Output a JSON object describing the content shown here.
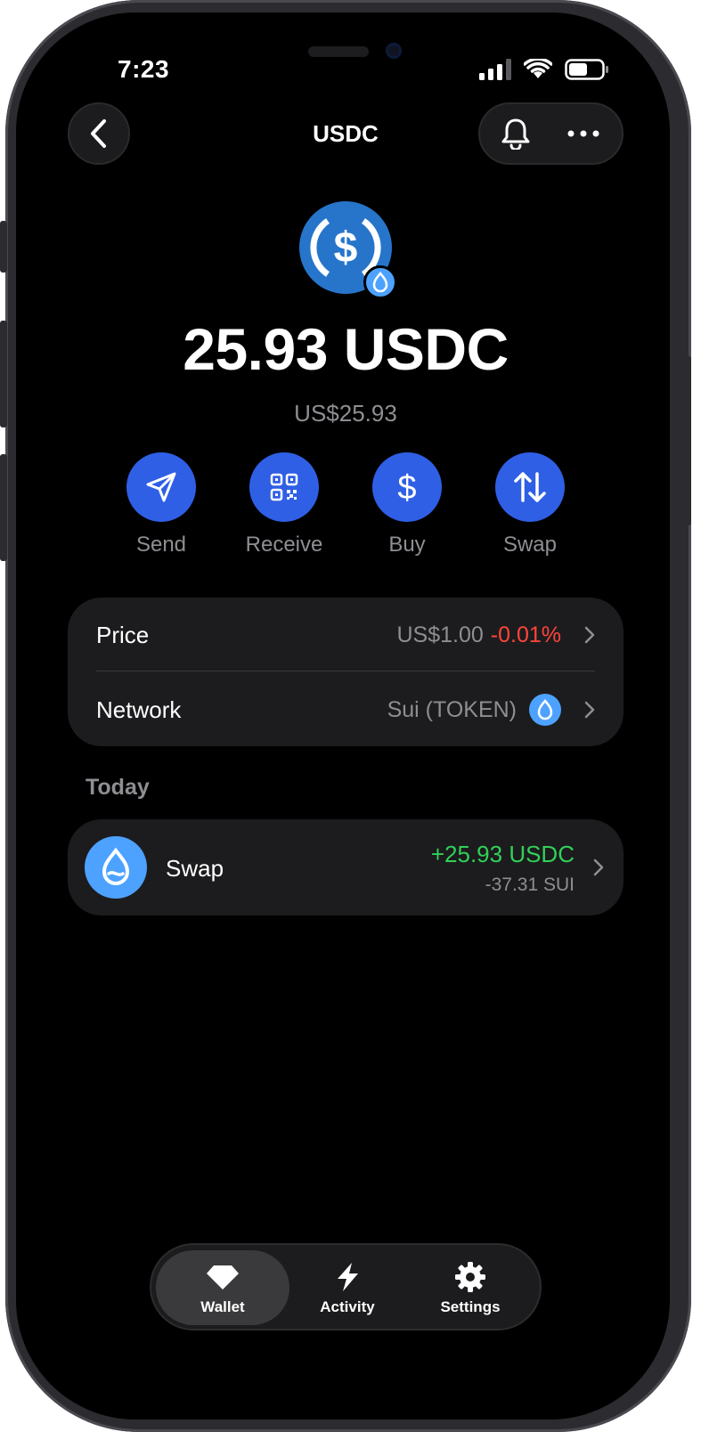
{
  "status_bar": {
    "time": "7:23"
  },
  "nav": {
    "title": "USDC",
    "back_icon": "chevron-left-icon",
    "bell_icon": "bell-icon",
    "more_icon": "more-dots-icon"
  },
  "token": {
    "logo_icon": "usdc-logo-icon",
    "badge_icon": "sui-drop-icon",
    "balance": "25.93 USDC",
    "fiat_value": "US$25.93"
  },
  "actions": [
    {
      "label": "Send",
      "icon": "send-icon"
    },
    {
      "label": "Receive",
      "icon": "qr-code-icon"
    },
    {
      "label": "Buy",
      "icon": "dollar-icon"
    },
    {
      "label": "Swap",
      "icon": "swap-arrows-icon"
    }
  ],
  "info": {
    "price_label": "Price",
    "price_value": "US$1.00",
    "price_change": "-0.01%",
    "network_label": "Network",
    "network_value": "Sui (TOKEN)"
  },
  "activity": {
    "section_label": "Today",
    "transactions": [
      {
        "title": "Swap",
        "amount_in": "+25.93 USDC",
        "amount_out": "-37.31 SUI"
      }
    ]
  },
  "tabbar": {
    "tabs": [
      {
        "label": "Wallet",
        "icon": "diamond-icon",
        "active": true
      },
      {
        "label": "Activity",
        "icon": "lightning-icon",
        "active": false
      },
      {
        "label": "Settings",
        "icon": "gear-icon",
        "active": false
      }
    ]
  },
  "colors": {
    "accent": "#2f5fe5",
    "sui_blue": "#4da2ff",
    "negative": "#ff453a",
    "positive": "#30d158"
  }
}
